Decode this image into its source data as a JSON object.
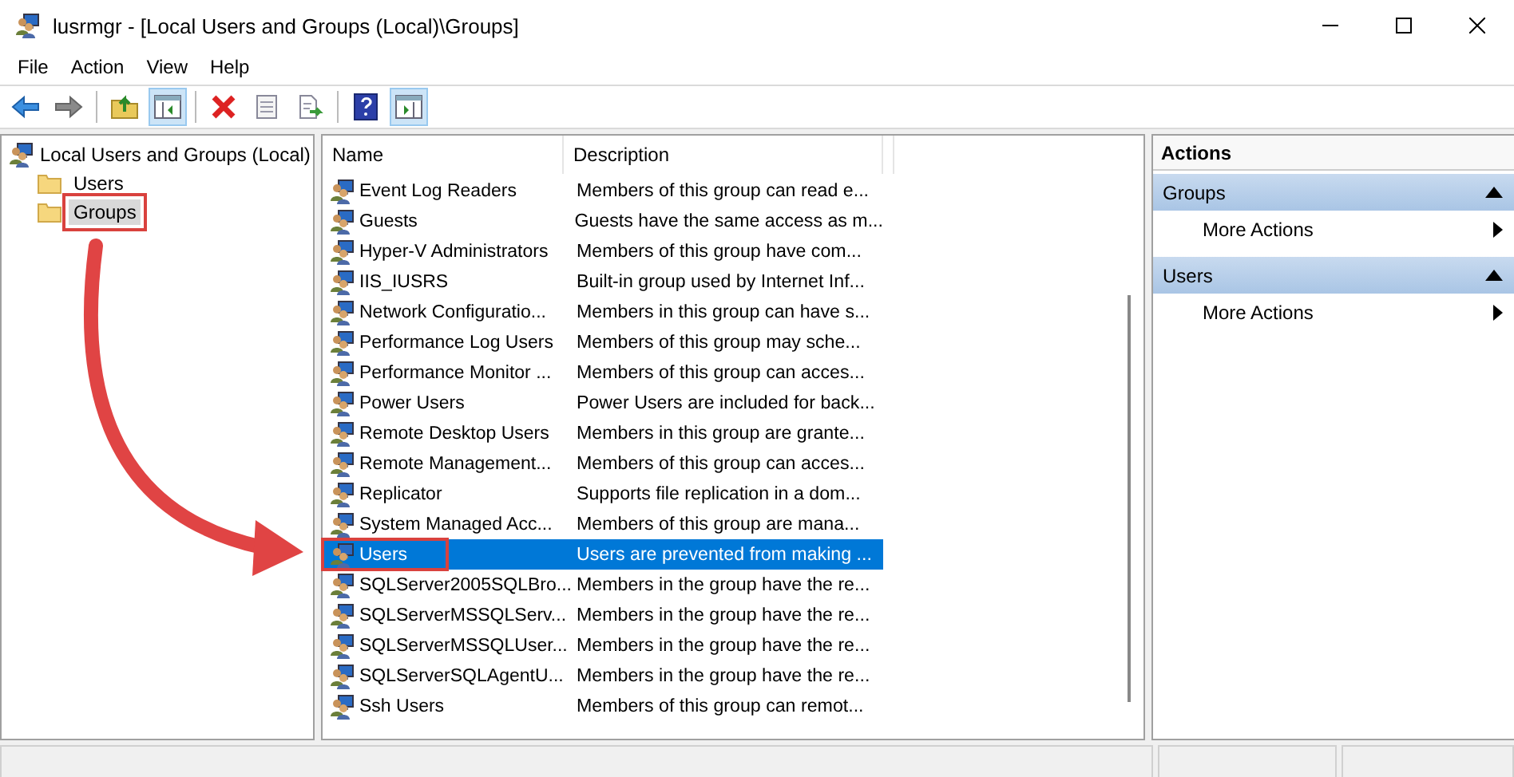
{
  "window": {
    "title": "lusrmgr - [Local Users and Groups (Local)\\Groups]"
  },
  "menu": [
    "File",
    "Action",
    "View",
    "Help"
  ],
  "toolbar": [
    {
      "kind": "back",
      "pressed": false
    },
    {
      "kind": "forward",
      "pressed": false
    },
    {
      "kind": "separator"
    },
    {
      "kind": "up",
      "pressed": false
    },
    {
      "kind": "tree",
      "pressed": true
    },
    {
      "kind": "separator"
    },
    {
      "kind": "delete",
      "pressed": false
    },
    {
      "kind": "properties",
      "pressed": false
    },
    {
      "kind": "export",
      "pressed": false
    },
    {
      "kind": "separator"
    },
    {
      "kind": "help",
      "pressed": false
    },
    {
      "kind": "actionpane",
      "pressed": true
    }
  ],
  "tree": {
    "label": "Local Users and Groups (Local)",
    "children": [
      {
        "label": "Users",
        "selected": false,
        "highlighted": false
      },
      {
        "label": "Groups",
        "selected": true,
        "highlighted": true
      }
    ]
  },
  "list": {
    "columns": [
      "Name",
      "Description"
    ],
    "rows": [
      {
        "name": "Event Log Readers",
        "description": "Members of this group can read e...",
        "selected": false,
        "highlighted": false
      },
      {
        "name": "Guests",
        "description": "Guests have the same access as m...",
        "selected": false,
        "highlighted": false
      },
      {
        "name": "Hyper-V Administrators",
        "description": "Members of this group have com...",
        "selected": false,
        "highlighted": false
      },
      {
        "name": "IIS_IUSRS",
        "description": "Built-in group used by Internet Inf...",
        "selected": false,
        "highlighted": false
      },
      {
        "name": "Network Configuratio...",
        "description": "Members in this group can have s...",
        "selected": false,
        "highlighted": false
      },
      {
        "name": "Performance Log Users",
        "description": "Members of this group may sche...",
        "selected": false,
        "highlighted": false
      },
      {
        "name": "Performance Monitor ...",
        "description": "Members of this group can acces...",
        "selected": false,
        "highlighted": false
      },
      {
        "name": "Power Users",
        "description": "Power Users are included for back...",
        "selected": false,
        "highlighted": false
      },
      {
        "name": "Remote Desktop Users",
        "description": "Members in this group are grante...",
        "selected": false,
        "highlighted": false
      },
      {
        "name": "Remote Management...",
        "description": "Members of this group can acces...",
        "selected": false,
        "highlighted": false
      },
      {
        "name": "Replicator",
        "description": "Supports file replication in a dom...",
        "selected": false,
        "highlighted": false
      },
      {
        "name": "System Managed Acc...",
        "description": "Members of this group are mana...",
        "selected": false,
        "highlighted": false
      },
      {
        "name": "Users",
        "description": "Users are prevented from making ...",
        "selected": true,
        "highlighted": true
      },
      {
        "name": "SQLServer2005SQLBro...",
        "description": "Members in the group have the re...",
        "selected": false,
        "highlighted": false
      },
      {
        "name": "SQLServerMSSQLServ...",
        "description": "Members in the group have the re...",
        "selected": false,
        "highlighted": false
      },
      {
        "name": "SQLServerMSSQLUser...",
        "description": "Members in the group have the re...",
        "selected": false,
        "highlighted": false
      },
      {
        "name": "SQLServerSQLAgentU...",
        "description": "Members in the group have the re...",
        "selected": false,
        "highlighted": false
      },
      {
        "name": "Ssh Users",
        "description": "Members of this group can remot...",
        "selected": false,
        "highlighted": false
      }
    ]
  },
  "actions": {
    "title": "Actions",
    "sections": [
      {
        "heading": "Groups",
        "expanded": true,
        "items": [
          "More Actions"
        ]
      },
      {
        "heading": "Users",
        "expanded": true,
        "items": [
          "More Actions"
        ]
      }
    ]
  },
  "annotation": {
    "arrow": true
  }
}
